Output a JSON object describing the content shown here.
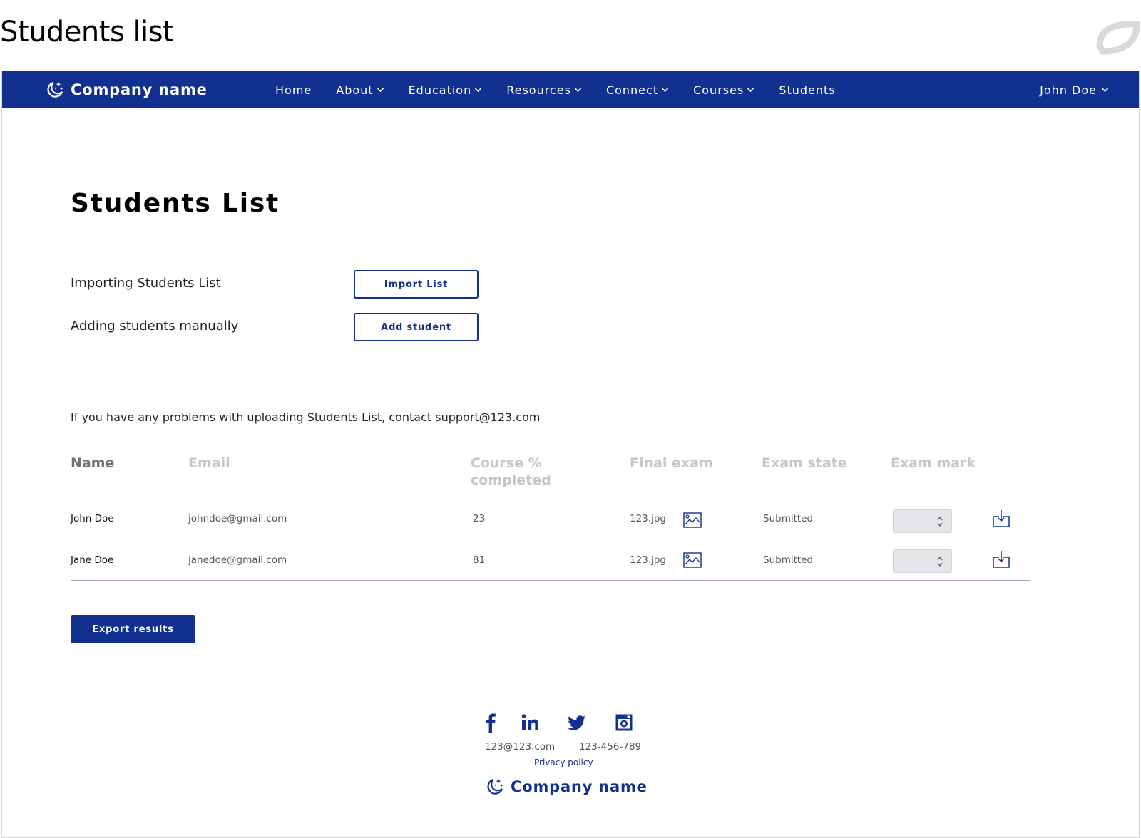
{
  "doc": {
    "title": "Students list"
  },
  "colors": {
    "brand": "#12308f",
    "header_muted": "#c4c7cc",
    "stepper_bg": "#e3e5e9"
  },
  "navbar": {
    "brand": "Company name",
    "items": [
      {
        "label": "Home",
        "dropdown": false
      },
      {
        "label": "About",
        "dropdown": true
      },
      {
        "label": "Education",
        "dropdown": true
      },
      {
        "label": "Resources",
        "dropdown": true
      },
      {
        "label": "Connect",
        "dropdown": true
      },
      {
        "label": "Courses",
        "dropdown": true
      },
      {
        "label": "Students",
        "dropdown": false
      }
    ],
    "user": "John Doe"
  },
  "main": {
    "heading": "Students List",
    "import": {
      "label": "Importing Students List",
      "button": "Import List"
    },
    "add": {
      "label": "Adding students manually",
      "button": "Add student"
    },
    "notice": "If you have any problems with uploading Students List, contact support@123.com"
  },
  "table": {
    "columns": {
      "name": "Name",
      "email": "Email",
      "course_line1": "Course %",
      "course_line2": "completed",
      "final_exam": "Final exam",
      "exam_state": "Exam state",
      "exam_mark": "Exam mark"
    },
    "rows": [
      {
        "name": "John Doe",
        "email": "johndoe@gmail.com",
        "course": "23",
        "file": "123.jpg",
        "state": "Submitted"
      },
      {
        "name": "Jane Doe",
        "email": "janedoe@gmail.com",
        "course": "81",
        "file": "123.jpg",
        "state": "Submitted"
      }
    ]
  },
  "export_button": "Export results",
  "footer": {
    "social": [
      "facebook-icon",
      "linkedin-icon",
      "twitter-icon",
      "instagram-icon"
    ],
    "email": "123@123.com",
    "phone": "123-456-789",
    "privacy": "Privacy policy",
    "brand": "Company name"
  }
}
